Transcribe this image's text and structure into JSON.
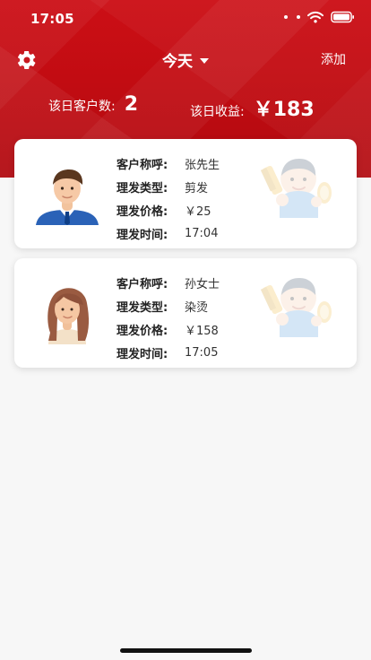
{
  "status": {
    "time": "17:05"
  },
  "header": {
    "title": "今天",
    "add_label": "添加",
    "stats": {
      "customers_label": "该日客户数:",
      "customers_value": "2",
      "revenue_label": "该日收益:",
      "revenue_value": "￥183"
    }
  },
  "cards": [
    {
      "fields": [
        {
          "label": "客户称呼:",
          "value": "张先生"
        },
        {
          "label": "理发类型:",
          "value": "剪发"
        },
        {
          "label": "理发价格:",
          "value": "￥25"
        },
        {
          "label": "理发时间:",
          "value": "17:04"
        }
      ],
      "avatar": "male-customer-icon",
      "watermark": "barber-icon"
    },
    {
      "fields": [
        {
          "label": "客户称呼:",
          "value": "孙女士"
        },
        {
          "label": "理发类型:",
          "value": "染烫"
        },
        {
          "label": "理发价格:",
          "value": "￥158"
        },
        {
          "label": "理发时间:",
          "value": "17:05"
        }
      ],
      "avatar": "female-customer-icon",
      "watermark": "barber-icon"
    }
  ],
  "colors": {
    "header_red": "#c20c12",
    "card_bg": "#ffffff",
    "background": "#f7f7f7"
  }
}
